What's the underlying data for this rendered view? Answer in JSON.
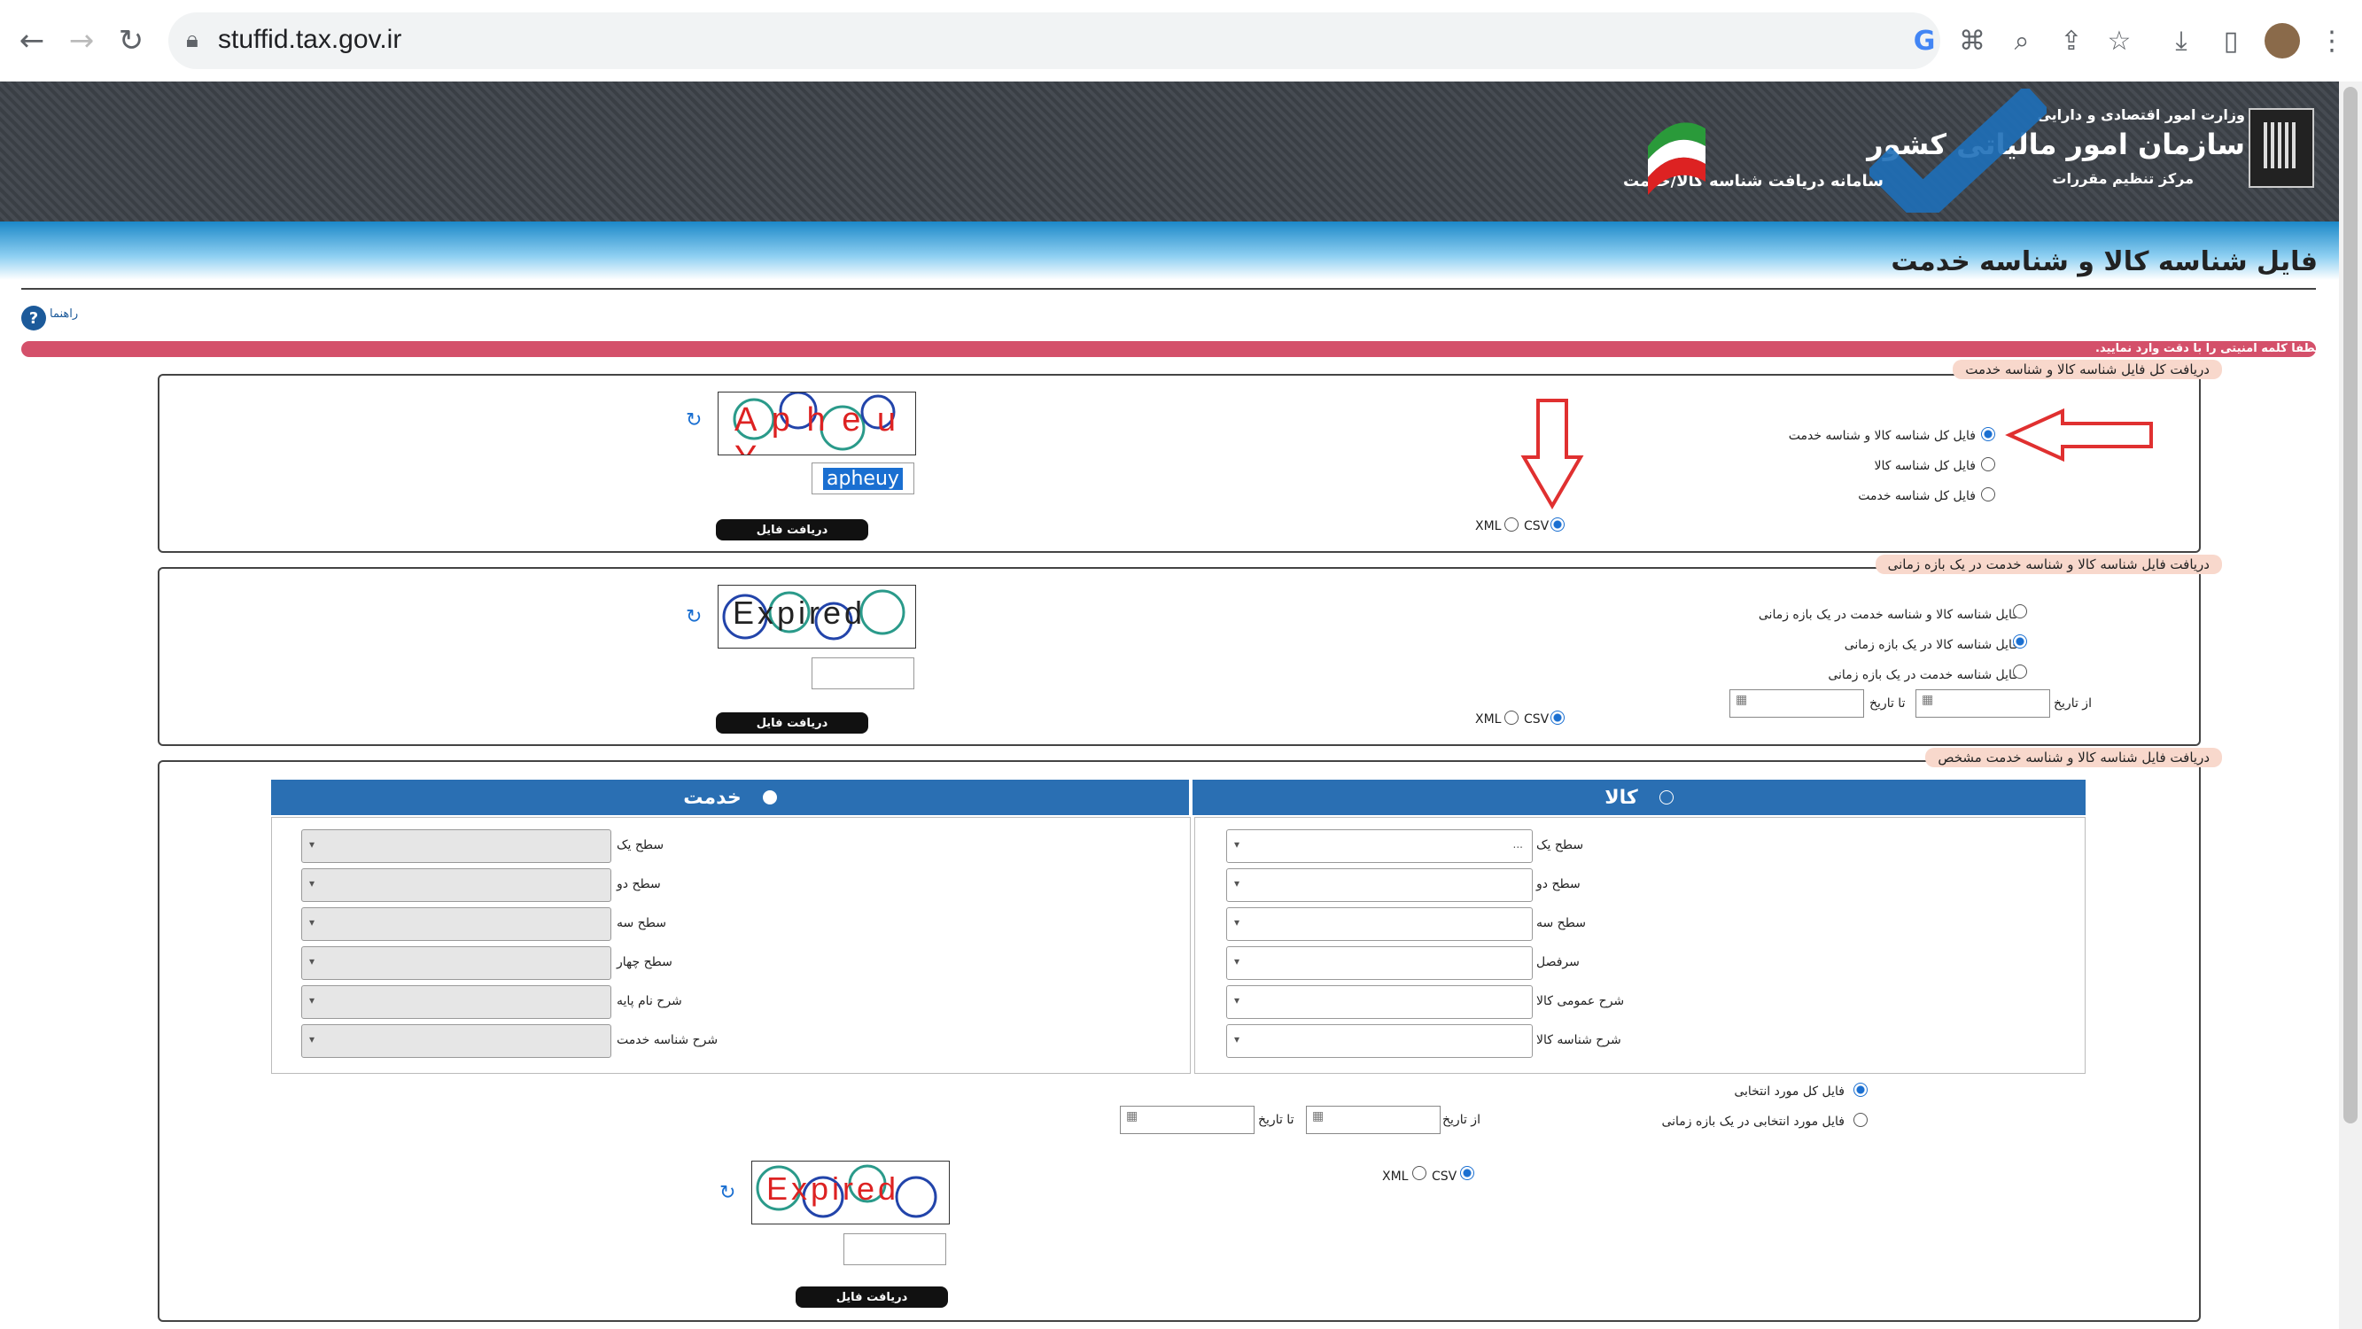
{
  "browser": {
    "url": "stuffid.tax.gov.ir"
  },
  "banner": {
    "ministry": "وزارت امور اقتصادی و دارایی",
    "org_name": "سازمان امور مالیاتی کشور",
    "center": "مرکز تنظیم مقررات",
    "system_name": "سامانه دریافت شناسه کالا/خدمت"
  },
  "page": {
    "title": "فایل شناسه کالا و شناسه خدمت",
    "help_label": "راهنما",
    "notice": "لطفا کلمه امنیتی را با دقت وارد نمایید."
  },
  "section1": {
    "legend": "دریافت کل فایل شناسه کالا و شناسه خدمت",
    "options": [
      {
        "label": "فایل کل شناسه کالا و شناسه خدمت",
        "selected": true
      },
      {
        "label": "فایل کل شناسه کالا",
        "selected": false
      },
      {
        "label": "فایل کل شناسه خدمت",
        "selected": false
      }
    ],
    "format_xml": "XML",
    "format_csv": "CSV",
    "format_selected": "CSV",
    "captcha_text": "A p h e u Y",
    "captcha_input": "apheuy",
    "download_label": "دریافت فایل"
  },
  "section2": {
    "legend": "دریافت فایل شناسه کالا و شناسه خدمت در یک بازه زمانی",
    "options": [
      {
        "label": "فایل شناسه کالا و شناسه خدمت در یک بازه زمانی",
        "selected": false
      },
      {
        "label": "فایل شناسه کالا در یک بازه زمانی",
        "selected": true
      },
      {
        "label": "فایل شناسه خدمت در یک بازه زمانی",
        "selected": false
      }
    ],
    "from_label": "از تاریخ",
    "to_label": "تا تاریخ",
    "format_xml": "XML",
    "format_csv": "CSV",
    "format_selected": "CSV",
    "captcha_text": "Expired",
    "captcha_input": "",
    "download_label": "دریافت فایل"
  },
  "section3": {
    "legend": "دریافت فایل شناسه کالا و شناسه خدمت مشخص",
    "goods": {
      "header": "کالا",
      "selected": false,
      "fields": [
        {
          "label": "سطح یک",
          "value": "..."
        },
        {
          "label": "سطح دو",
          "value": ""
        },
        {
          "label": "سطح سه",
          "value": ""
        },
        {
          "label": "سرفصل",
          "value": ""
        },
        {
          "label": "شرح عمومی کالا",
          "value": ""
        },
        {
          "label": "شرح شناسه کالا",
          "value": ""
        }
      ]
    },
    "service": {
      "header": "خدمت",
      "selected": true,
      "fields": [
        {
          "label": "سطح یک",
          "value": ""
        },
        {
          "label": "سطح دو",
          "value": ""
        },
        {
          "label": "سطح سه",
          "value": ""
        },
        {
          "label": "سطح چهار",
          "value": ""
        },
        {
          "label": "شرح نام پایه",
          "value": ""
        },
        {
          "label": "شرح شناسه خدمت",
          "value": ""
        }
      ]
    },
    "options": [
      {
        "label": "فایل کل مورد انتخابی",
        "selected": true
      },
      {
        "label": "فایل مورد انتخابی در یک بازه زمانی",
        "selected": false
      }
    ],
    "from_label": "از تاریخ",
    "to_label": "تا تاریخ",
    "format_xml": "XML",
    "format_csv": "CSV",
    "format_selected": "CSV",
    "captcha_text": "Expired",
    "captcha_input": "",
    "download_label": "دریافت فایل"
  },
  "colors": {
    "accent_blue": "#2a6fb3",
    "notice_red": "#d4506a",
    "annotation_red": "#e03030"
  }
}
